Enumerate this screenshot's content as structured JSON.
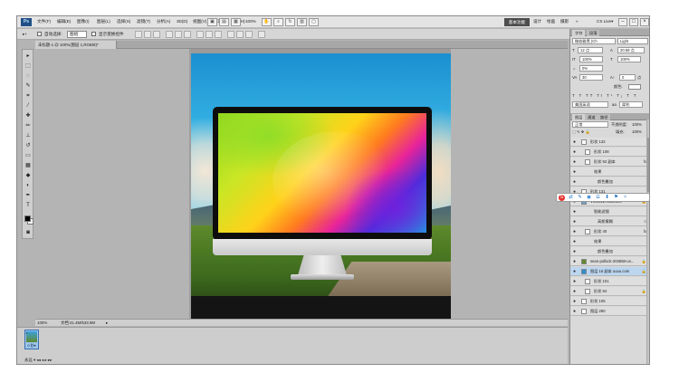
{
  "menubar": {
    "logo": "Ps",
    "menus": [
      "文件(F)",
      "编辑(E)",
      "图像(I)",
      "图层(L)",
      "选择(S)",
      "滤镜(T)",
      "分析(A)",
      "3D(D)",
      "视图(V)",
      "窗口(W)",
      "帮助(H)"
    ],
    "zoom": "100%",
    "active_workspace": "基本功能",
    "workspaces": [
      "设计",
      "绘画",
      "摄影"
    ],
    "more": "»",
    "cs_live": "CS Live▾",
    "win_min": "–",
    "win_max": "□",
    "win_close": "×"
  },
  "options": {
    "auto_select": "自动选择:",
    "auto_select_value": "图组",
    "show_transform": "显示变换控件"
  },
  "document": {
    "tab_title": "未标题-1 @ 100%(图层 1,RGB/8)*"
  },
  "status": {
    "zoom": "100%",
    "doc_info": "文档:41.4M/533.9M",
    "arrow": "▸"
  },
  "animation": {
    "frame_number": "1",
    "frame_duration": "0 秒▾",
    "controls": "永远 ▾  ◂◂ ◂ ▸ ▸▸"
  },
  "character_panel": {
    "tabs": [
      "字符",
      "段落"
    ],
    "font_family": "微软雅黑 (Ch",
    "font_style": "Light",
    "font_size": "12 点",
    "leading": "20.59 点",
    "vertical_scale": "100%",
    "horizontal_scale": "100%",
    "tracking": "0%",
    "kerning": "30",
    "baseline": "0",
    "baseline_unit": "点",
    "color_label": "颜色:",
    "language": "美国英语",
    "antialias": "犀利"
  },
  "layers_panel": {
    "tabs": [
      "图层",
      "通道",
      "路径"
    ],
    "blend_mode": "正常",
    "opacity_label": "不透明度:",
    "opacity": "100%",
    "fill_label": "填充:",
    "fill": "100%",
    "layers": [
      {
        "name": "形状 132",
        "fx": "",
        "lock": ""
      },
      {
        "name": "形状 108",
        "fx": "",
        "lock": ""
      },
      {
        "name": "形状 92 副本",
        "fx": "fx",
        "lock": ""
      },
      {
        "name": "效果",
        "fx": "",
        "lock": ""
      },
      {
        "name": "颜色叠加",
        "fx": "",
        "lock": ""
      },
      {
        "name": "形状 131",
        "fx": "",
        "lock": ""
      },
      {
        "name": "VCG41273480099",
        "fx": "",
        "lock": "🔒"
      },
      {
        "name": "智能滤镜",
        "fx": "",
        "lock": ""
      },
      {
        "name": "高斯模糊",
        "fx": "",
        "lock": "≡"
      },
      {
        "name": "形状 40",
        "fx": "fx",
        "lock": ""
      },
      {
        "name": "效果",
        "fx": "",
        "lock": ""
      },
      {
        "name": "颜色叠加",
        "fx": "",
        "lock": ""
      },
      {
        "name": "sean-pollock-203658-un...",
        "fx": "",
        "lock": "🔒"
      },
      {
        "name": "图层 16 副本 uuuu.com",
        "fx": "",
        "lock": "🔒"
      },
      {
        "name": "形状 101",
        "fx": "",
        "lock": ""
      },
      {
        "name": "形状 94",
        "fx": "",
        "lock": "🔒"
      },
      {
        "name": "形状 105",
        "fx": "",
        "lock": ""
      },
      {
        "name": "图层 280",
        "fx": "",
        "lock": ""
      }
    ]
  },
  "popup": {
    "icons": [
      "S",
      "⇄",
      "✎",
      "◉",
      "☰",
      "⬇",
      "⚑",
      "✧"
    ]
  },
  "colors": {
    "workspace_bg": "#b4b4b4",
    "panel_bg": "#d9d9d9",
    "accent": "#1f4f86",
    "selection": "#bcd6f0"
  }
}
